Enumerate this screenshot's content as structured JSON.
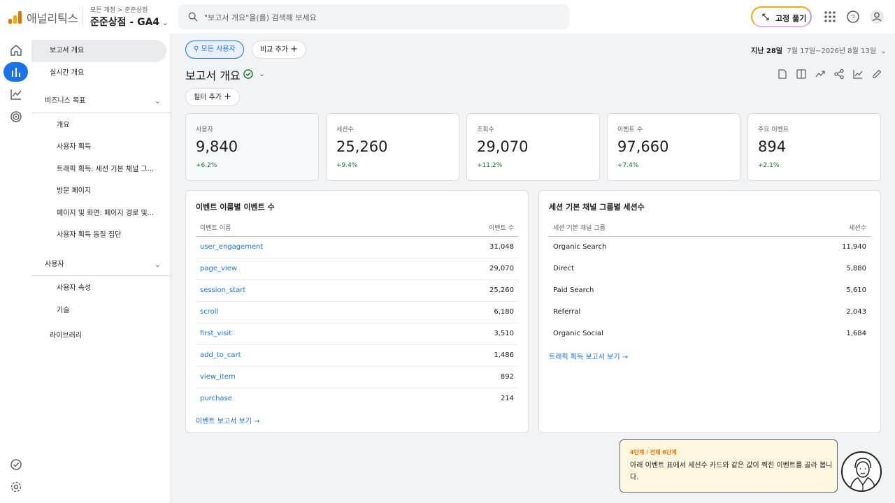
{
  "header": {
    "app_name": "애널리틱스",
    "breadcrumb": "모든 계정 > 준준상점",
    "property": "준준상점 - GA4",
    "search_placeholder": "\"보고서 개요\"을(를) 검색해 보세요",
    "pin_label": "고정 풀기"
  },
  "sidebar": {
    "items": [
      {
        "label": "보고서 개요"
      },
      {
        "label": "실시간 개요"
      },
      {
        "label": "비즈니스 목표"
      },
      {
        "label": "개요"
      },
      {
        "label": "사용자 획득"
      },
      {
        "label": "트래픽 획득: 세션 기본 채널 그..."
      },
      {
        "label": "방문 페이지"
      },
      {
        "label": "페이지 및 화면: 페이지 경로 및..."
      },
      {
        "label": "사용자 획득 동질 집단"
      },
      {
        "label": "사용자"
      },
      {
        "label": "사용자 속성"
      },
      {
        "label": "기술"
      },
      {
        "label": "라이브러리"
      }
    ]
  },
  "toolbar": {
    "segment_chip": "모든 사용자",
    "compare_chip": "비교 추가",
    "date_label": "지난 28일",
    "date_range": "7월 17일~2026년 8월 13일",
    "page_title": "보고서 개요",
    "filter_chip": "필터 추가"
  },
  "kpis": [
    {
      "label": "사용자",
      "value": "9,840",
      "delta": "+6.2%"
    },
    {
      "label": "세션수",
      "value": "25,260",
      "delta": "+9.4%"
    },
    {
      "label": "조회수",
      "value": "29,070",
      "delta": "+11.2%"
    },
    {
      "label": "이벤트 수",
      "value": "97,660",
      "delta": "+7.4%"
    },
    {
      "label": "주요 이벤트",
      "value": "894",
      "delta": "+2.1%"
    }
  ],
  "events_table": {
    "title": "이벤트 이름별 이벤트 수",
    "col1": "이벤트 이름",
    "col2": "이벤트 수",
    "rows": [
      {
        "name": "user_engagement",
        "count": "31,048"
      },
      {
        "name": "page_view",
        "count": "29,070"
      },
      {
        "name": "session_start",
        "count": "25,260"
      },
      {
        "name": "scroll",
        "count": "6,180"
      },
      {
        "name": "first_visit",
        "count": "3,510"
      },
      {
        "name": "add_to_cart",
        "count": "1,486"
      },
      {
        "name": "view_item",
        "count": "892"
      },
      {
        "name": "purchase",
        "count": "214"
      }
    ],
    "link": "이벤트 보고서 보기"
  },
  "channels_table": {
    "title": "세션 기본 채널 그룹별 세션수",
    "col1": "세션 기본 채널 그룹",
    "col2": "세션수",
    "rows": [
      {
        "name": "Organic Search",
        "count": "11,940"
      },
      {
        "name": "Direct",
        "count": "5,880"
      },
      {
        "name": "Paid Search",
        "count": "5,610"
      },
      {
        "name": "Referral",
        "count": "2,043"
      },
      {
        "name": "Organic Social",
        "count": "1,684"
      }
    ],
    "link": "트래픽 획득 보고서 보기"
  },
  "tooltip": {
    "step": "4단계 / 전체 6단계",
    "message": "아래 이벤트 표에서 세션수 카드와 같은 값이 찍힌 이벤트를 골라 봅니다."
  },
  "colors": {
    "accent": "#1a73e8",
    "positive": "#137333",
    "brand_orange": "#e37400"
  }
}
